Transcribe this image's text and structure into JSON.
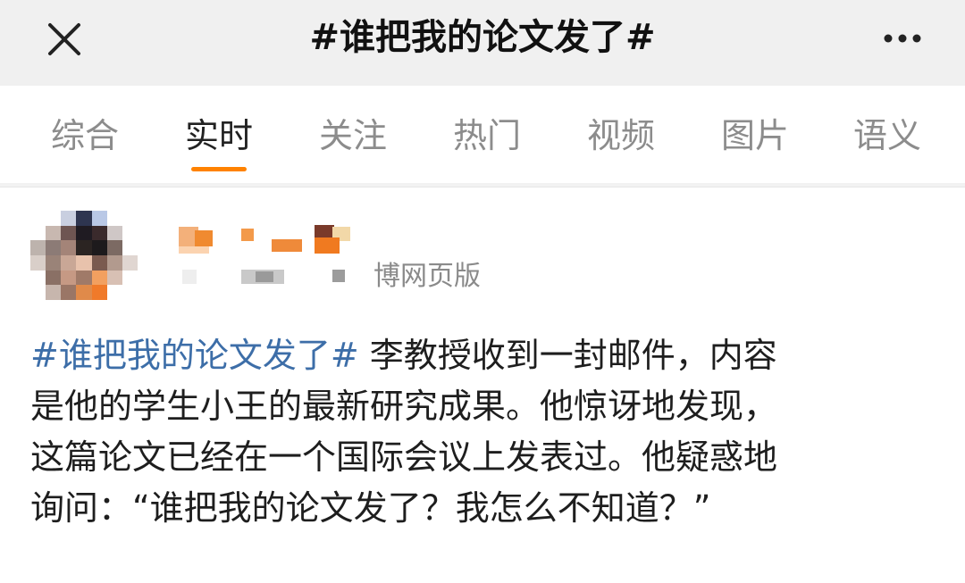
{
  "header": {
    "title": "#谁把我的论文发了#",
    "close_icon": "close-icon",
    "more_icon": "more-horizontal-icon"
  },
  "tabs": [
    {
      "label": "综合",
      "active": false
    },
    {
      "label": "实时",
      "active": true
    },
    {
      "label": "关注",
      "active": false
    },
    {
      "label": "热门",
      "active": false
    },
    {
      "label": "视频",
      "active": false
    },
    {
      "label": "图片",
      "active": false
    },
    {
      "label": "语义",
      "active": false
    }
  ],
  "colors": {
    "accent": "#ff8200",
    "hashtag": "#3d6ea8",
    "header_bg": "#f0f0f0"
  },
  "post": {
    "source_suffix": "博网页版",
    "hashtag": "#谁把我的论文发了#",
    "line1_rest": " 李教授收到一封邮件，内容",
    "line2": "是他的学生小王的最新研究成果。他惊讶地发现，",
    "line3": "这篇论文已经在一个国际会议上发表过。他疑惑地",
    "line4": "询问：“谁把我的论文发了？我怎么不知道？”"
  }
}
